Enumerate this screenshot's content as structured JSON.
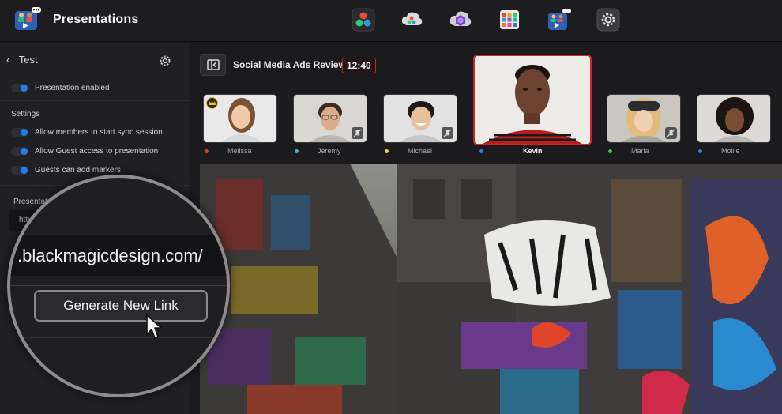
{
  "app": {
    "title": "Presentations"
  },
  "toolbar_apps": [
    {
      "icon": "resolve-icon"
    },
    {
      "icon": "resolve-cloud-icon"
    },
    {
      "icon": "cloud-hexagon-icon"
    },
    {
      "icon": "library-icon"
    },
    {
      "icon": "presentations-icon"
    },
    {
      "icon": "settings-icon"
    }
  ],
  "sidebar": {
    "back_label": "Test",
    "presentation_enabled": "Presentation enabled",
    "settings_heading": "Settings",
    "options": [
      {
        "label": "Allow members to start sync session",
        "on": true
      },
      {
        "label": "Allow Guest access to presentation",
        "on": true
      },
      {
        "label": "Guests can add markers",
        "on": true
      }
    ],
    "presentation_label": "Presentati",
    "link_value": "http"
  },
  "session": {
    "title": "Social Media Ads Review",
    "timer": "12:40"
  },
  "participants": [
    {
      "name": "Melissa",
      "status_color": "#d93a3a",
      "host": true,
      "muted": false,
      "active": false
    },
    {
      "name": "Jeremy",
      "status_color": "#2ec4c4",
      "host": false,
      "muted": true,
      "active": false
    },
    {
      "name": "Michael",
      "status_color": "#e3d94a",
      "host": false,
      "muted": true,
      "active": false
    },
    {
      "name": "Kevin",
      "status_color": "#2a7de1",
      "host": false,
      "muted": false,
      "active": true
    },
    {
      "name": "Maria",
      "status_color": "#3ac06a",
      "host": false,
      "muted": true,
      "active": false
    },
    {
      "name": "Mollie",
      "status_color": "#2a7de1",
      "host": false,
      "muted": false,
      "active": false
    }
  ],
  "magnifier": {
    "url_text": ".blackmagicdesign.com/",
    "button_label": "Generate New Link"
  },
  "colors": {
    "accent": "#1e7cf2",
    "live": "#d02323"
  }
}
